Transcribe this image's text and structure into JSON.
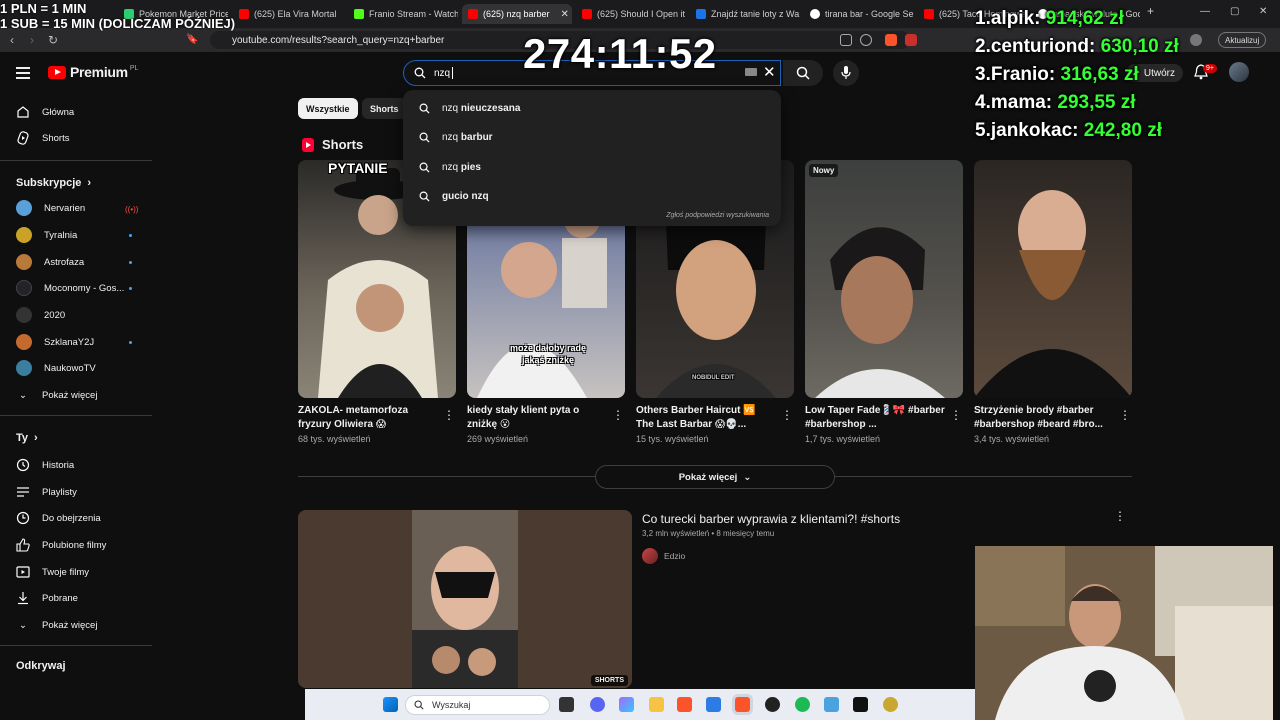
{
  "browser": {
    "tabs": [
      {
        "label": "Pokemon Market Price",
        "color": "#2ecc71"
      },
      {
        "label": "(625) Ela Vira Mortal",
        "color": "#ff0000"
      },
      {
        "label": "Franio Stream - Watch",
        "color": "#53fc18"
      },
      {
        "label": "(625) nzq barber",
        "color": "#ff0000"
      },
      {
        "label": "(625) Should I Open it",
        "color": "#ff0000"
      },
      {
        "label": "Znajdź tanie loty z Wa",
        "color": "#1a73e8"
      },
      {
        "label": "tirana bar - Google Se",
        "color": "#ffffff"
      },
      {
        "label": "(625) Taco Hemingwa",
        "color": "#ff0000"
      },
      {
        "label": "albanska waluta - Goo",
        "color": "#ffffff"
      }
    ],
    "active_tab_close": "✕",
    "new_tab": "+",
    "url": "youtube.com/results?search_query=nzq+barber",
    "update_button": "Aktualizuj"
  },
  "overlay": {
    "timer": "274:11:52",
    "stream_note_line1": "1 PLN = 1 MIN",
    "stream_note_line2": "1 SUB = 15 MIN (DOLICZAM PÓŹNIEJ)",
    "leaderboard": [
      {
        "rank": "1.",
        "name": "alpik:",
        "amount": "914,62 zł"
      },
      {
        "rank": "2.",
        "name": "centuriond:",
        "amount": "630,10 zł"
      },
      {
        "rank": "3.",
        "name": "Franio:",
        "amount": "316,63 zł"
      },
      {
        "rank": "4.",
        "name": "mama:",
        "amount": "293,55 zł"
      },
      {
        "rank": "5.",
        "name": "jankokac:",
        "amount": "242,80 zł"
      }
    ]
  },
  "header": {
    "logo_text": "Premium",
    "logo_country": "PL",
    "search_value": "nzq",
    "create_label": "Utwórz",
    "notifications_badge": "9+"
  },
  "suggestions": {
    "items": [
      {
        "prefix": "nzq",
        "rest": " nieuczesana"
      },
      {
        "prefix": "nzq",
        "rest": " barbur"
      },
      {
        "prefix": "nzq",
        "rest": " pies"
      },
      {
        "prefix": "",
        "rest": "gucio nzq"
      }
    ],
    "footer": "Zgłoś podpowiedzi wyszukiwania"
  },
  "sidebar": {
    "main": [
      {
        "label": "Główna",
        "icon": "home-icon"
      },
      {
        "label": "Shorts",
        "icon": "shorts-icon"
      }
    ],
    "subscriptions_title": "Subskrypcje",
    "subscriptions": [
      {
        "label": "Nervarien",
        "color": "#5aa0d8",
        "status": "live"
      },
      {
        "label": "Tyralnia",
        "color": "#c9a227",
        "status": "dot"
      },
      {
        "label": "Astrofaza",
        "color": "#b87a3a",
        "status": "dot"
      },
      {
        "label": "Moconomy - Gos...",
        "color": "#23232a",
        "status": "dot"
      },
      {
        "label": "2020",
        "color": "#333333",
        "status": "none"
      },
      {
        "label": "SzklanaY2J",
        "color": "#c46a2e",
        "status": "dot"
      },
      {
        "label": "NaukowoTV",
        "color": "#3a7fa0",
        "status": "none"
      }
    ],
    "subs_show_more": "Pokaż więcej",
    "you_title": "Ty",
    "you_items": [
      {
        "label": "Historia",
        "icon": "history-icon"
      },
      {
        "label": "Playlisty",
        "icon": "playlists-icon"
      },
      {
        "label": "Do obejrzenia",
        "icon": "watch-later-icon"
      },
      {
        "label": "Polubione filmy",
        "icon": "like-icon"
      },
      {
        "label": "Twoje filmy",
        "icon": "your-videos-icon"
      },
      {
        "label": "Pobrane",
        "icon": "download-icon"
      },
      {
        "label": "Pokaż więcej",
        "icon": "chevron-down-icon"
      }
    ],
    "explore_title": "Odkrywaj"
  },
  "chips": [
    "Wszystkie",
    "Shorts"
  ],
  "shorts": {
    "title": "Shorts",
    "items": [
      {
        "title": "ZAKOLA- metamorfoza fryzury Oliwiera 😱",
        "views": "68 tys. wyświetleń",
        "badge": "",
        "overlay": "PYTANIE",
        "bg1": "#2b2a28",
        "bg2": "#8a8477"
      },
      {
        "title": "kiedy stały klient pyta o zniżkę 😮",
        "views": "269 wyświetleń",
        "badge": "",
        "overlay": "może dałoby radę jakąś zniżkę",
        "bg1": "#3d4a7a",
        "bg2": "#c7c2c0"
      },
      {
        "title": "Others Barber Haircut 🆚 The Last Barbar 😱💀...",
        "views": "15 tys. wyświetleń",
        "badge": "",
        "overlay": "NOBIDUL EDIT",
        "bg1": "#1c1c1e",
        "bg2": "#3b3633"
      },
      {
        "title": "Low Taper Fade💈🎀 #barber #barbershop ...",
        "views": "1,7 tys. wyświetleń",
        "badge": "Nowy",
        "overlay": "",
        "bg1": "#3c3f3e",
        "bg2": "#6d6a63"
      },
      {
        "title": "Strzyżenie brody #barber #barbershop #beard #bro...",
        "views": "3,4 tys. wyświetleń",
        "badge": "",
        "overlay": "",
        "bg1": "#2a2623",
        "bg2": "#5c4b3e"
      }
    ],
    "show_more": "Pokaż więcej"
  },
  "video": {
    "title": "Co turecki barber wyprawia z klientami?! #shorts",
    "meta": "3,2 mln wyświetleń • 8 miesięcy temu",
    "channel": "Edzio",
    "badge": "SHORTS"
  },
  "taskbar": {
    "search_label": "Wyszukaj"
  }
}
